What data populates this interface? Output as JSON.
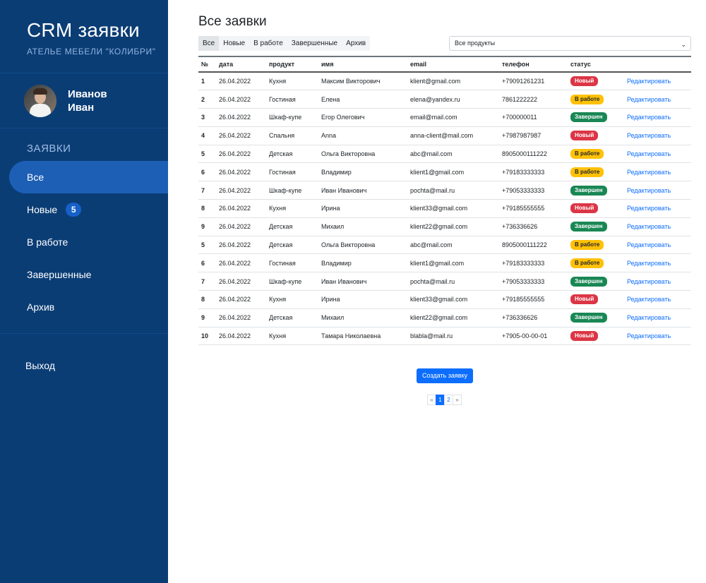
{
  "sidebar": {
    "title": "CRM заявки",
    "subtitle": "АТЕЛЬЕ МЕБЕЛИ \"КОЛИБРИ\"",
    "user": {
      "first_line": "Иванов",
      "second_line": "Иван"
    },
    "section_label": "ЗАЯВКИ",
    "items": [
      {
        "label": "Все"
      },
      {
        "label": "Новые",
        "badge": "5"
      },
      {
        "label": "В работе"
      },
      {
        "label": "Завершенные"
      },
      {
        "label": "Архив"
      }
    ],
    "logout": "Выход"
  },
  "main": {
    "title": "Все заявки",
    "tabs": [
      "Все",
      "Новые",
      "В работе",
      "Завершенные",
      "Архив"
    ],
    "product_select": "Все продукты",
    "columns": [
      "№",
      "дата",
      "продукт",
      "имя",
      "email",
      "телефон",
      "статус"
    ],
    "edit_label": "Редактировать",
    "rows": [
      {
        "num": "1",
        "date": "26.04.2022",
        "product": "Кухня",
        "name": "Максим Викторович",
        "email": "klient@gmail.com",
        "phone": "+79091261231",
        "status": "Новый",
        "status_type": "new"
      },
      {
        "num": "2",
        "date": "26.04.2022",
        "product": "Гостиная",
        "name": "Елена",
        "email": "elena@yandex.ru",
        "phone": "7861222222",
        "status": "В работе",
        "status_type": "work"
      },
      {
        "num": "3",
        "date": "26.04.2022",
        "product": "Шкаф-купе",
        "name": "Егор Олегович",
        "email": "email@mail.com",
        "phone": "+700000011",
        "status": "Завершен",
        "status_type": "done"
      },
      {
        "num": "4",
        "date": "26.04.2022",
        "product": "Спальня",
        "name": "Anna",
        "email": "anna-client@mail.com",
        "phone": "+7987987987",
        "status": "Новый",
        "status_type": "new"
      },
      {
        "num": "5",
        "date": "26.04.2022",
        "product": "Детская",
        "name": "Ольга Викторовна",
        "email": "abc@mail.com",
        "phone": "8905000111222",
        "status": "В работе",
        "status_type": "work"
      },
      {
        "num": "6",
        "date": "26.04.2022",
        "product": "Гостиная",
        "name": "Владимир",
        "email": "klient1@gmail.com",
        "phone": "+79183333333",
        "status": "В работе",
        "status_type": "work"
      },
      {
        "num": "7",
        "date": "26.04.2022",
        "product": "Шкаф-купе",
        "name": "Иван Иванович",
        "email": "pochta@mail.ru",
        "phone": "+79053333333",
        "status": "Завершен",
        "status_type": "done"
      },
      {
        "num": "8",
        "date": "26.04.2022",
        "product": "Кухня",
        "name": "Ирина",
        "email": "klient33@gmail.com",
        "phone": "+79185555555",
        "status": "Новый",
        "status_type": "new"
      },
      {
        "num": "9",
        "date": "26.04.2022",
        "product": "Детская",
        "name": "Михаил",
        "email": "klient22@gmail.com",
        "phone": "+736336626",
        "status": "Завершен",
        "status_type": "done"
      },
      {
        "num": "5",
        "date": "26.04.2022",
        "product": "Детская",
        "name": "Ольга Викторовна",
        "email": "abc@mail.com",
        "phone": "8905000111222",
        "status": "В работе",
        "status_type": "work"
      },
      {
        "num": "6",
        "date": "26.04.2022",
        "product": "Гостиная",
        "name": "Владимир",
        "email": "klient1@gmail.com",
        "phone": "+79183333333",
        "status": "В работе",
        "status_type": "work"
      },
      {
        "num": "7",
        "date": "26.04.2022",
        "product": "Шкаф-купе",
        "name": "Иван Иванович",
        "email": "pochta@mail.ru",
        "phone": "+79053333333",
        "status": "Завершен",
        "status_type": "done"
      },
      {
        "num": "8",
        "date": "26.04.2022",
        "product": "Кухня",
        "name": "Ирина",
        "email": "klient33@gmail.com",
        "phone": "+79185555555",
        "status": "Новый",
        "status_type": "new"
      },
      {
        "num": "9",
        "date": "26.04.2022",
        "product": "Детская",
        "name": "Михаил",
        "email": "klient22@gmail.com",
        "phone": "+736336626",
        "status": "Завершен",
        "status_type": "done"
      },
      {
        "num": "10",
        "date": "26.04.2022",
        "product": "Кухня",
        "name": "Тамара Николаевна",
        "email": "blabla@mail.ru",
        "phone": "+7905-00-00-01",
        "status": "Новый",
        "status_type": "new"
      }
    ],
    "create_button": "Создать заявку",
    "pagination": {
      "prev": "«",
      "pages": [
        "1",
        "2"
      ],
      "next": "»",
      "current": "1"
    }
  },
  "colors": {
    "sidebar_bg": "#0b3d75",
    "sidebar_active": "#1d5fb5",
    "accent": "#0d6efd",
    "status_new": "#dc3545",
    "status_work": "#ffc107",
    "status_done": "#198754"
  }
}
